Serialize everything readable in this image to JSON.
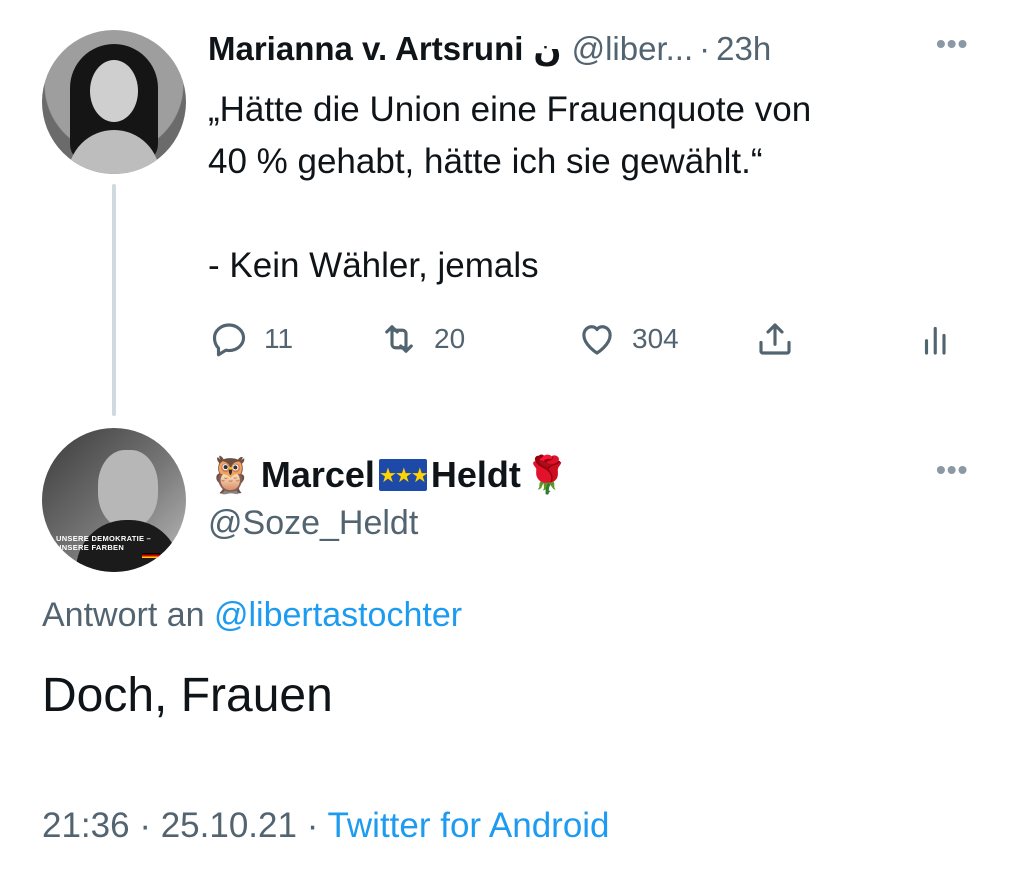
{
  "tweet1": {
    "author_name": "Marianna v. Artsruni",
    "author_suffix": "ن",
    "handle": "@liber...",
    "separator": "·",
    "time": "23h",
    "more_label": "•••",
    "text_lines": [
      "„Hätte die Union eine Frauenquote von",
      "40 % gehabt, hätte ich sie gewählt.“",
      "- Kein Wähler, jemals"
    ],
    "actions": {
      "reply": {
        "icon": "reply-icon",
        "count": "11"
      },
      "retweet": {
        "icon": "retweet-icon",
        "count": "20"
      },
      "like": {
        "icon": "heart-icon",
        "count": "304"
      },
      "share": {
        "icon": "share-icon"
      },
      "analytics": {
        "icon": "analytics-icon"
      }
    }
  },
  "tweet2": {
    "name_first": "Marcel",
    "name_last": "Heldt",
    "emoji_owl": "🦉",
    "emoji_eu": "★★★",
    "emoji_rose": "🌹",
    "handle": "@Soze_Heldt",
    "more_label": "•••",
    "avatar_overlay": [
      "UNSERE DEMOKRATIE –",
      "UNSERE FARBEN"
    ],
    "reply_prefix": "Antwort an",
    "reply_to": "@libertastochter",
    "text": "Doch, Frauen",
    "time": "21:36",
    "date": "25.10.21",
    "source": "Twitter for Android",
    "sep1": "·",
    "sep2": "·"
  },
  "colors": {
    "text": "#0f1419",
    "secondary": "#536471",
    "link": "#1d9bf0",
    "thread_line": "#cfd9de"
  }
}
